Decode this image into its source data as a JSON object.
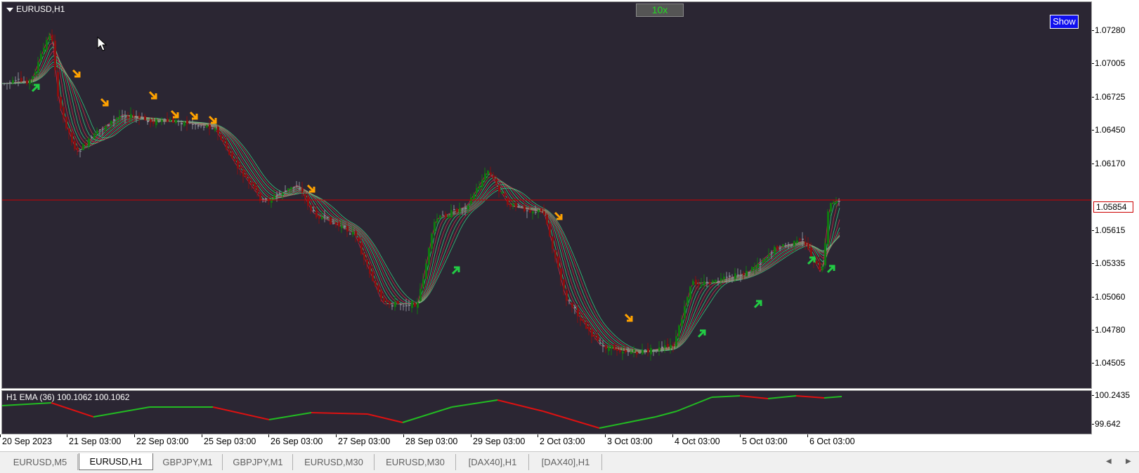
{
  "chart": {
    "symbol_label": "EURUSD,H1",
    "zoom_label": "10x",
    "show_label": "Show",
    "indicator_label": "H1 EMA (36) 100.1062 100.1062",
    "current_price": "1.05854",
    "current_price_value": 1.05854
  },
  "price_axis": {
    "ticks": [
      "1.07280",
      "1.07005",
      "1.06725",
      "1.06450",
      "1.06170",
      "1.05615",
      "1.05335",
      "1.05060",
      "1.04780",
      "1.04505"
    ]
  },
  "indicator_axis": {
    "ticks": [
      "100.2435",
      "99.642"
    ]
  },
  "time_axis": {
    "ticks": [
      "20 Sep 2023",
      "21 Sep 03:00",
      "22 Sep 03:00",
      "25 Sep 03:00",
      "26 Sep 03:00",
      "27 Sep 03:00",
      "28 Sep 03:00",
      "29 Sep 03:00",
      "2 Oct 03:00",
      "3 Oct 03:00",
      "4 Oct 03:00",
      "5 Oct 03:00",
      "6 Oct 03:00"
    ]
  },
  "tabs": [
    {
      "label": "EURUSD,M5",
      "active": false
    },
    {
      "label": "EURUSD,H1",
      "active": true
    },
    {
      "label": "GBPJPY,M1",
      "active": false
    },
    {
      "label": "GBPJPY,M1",
      "active": false
    },
    {
      "label": "EURUSD,M30",
      "active": false
    },
    {
      "label": "EURUSD,M30",
      "active": false
    },
    {
      "label": "[DAX40],H1",
      "active": false
    },
    {
      "label": "[DAX40],H1",
      "active": false
    }
  ],
  "nav": {
    "left_icon": "scroll-left-icon",
    "right_icon": "scroll-right-icon"
  },
  "colors": {
    "background": "#2b2633",
    "bull": "#0f7a0f",
    "bear": "#8b0f0f",
    "neutral": "#8a8d99",
    "ribbon_up": "#33ff99",
    "ribbon_down": "#ff2a4f",
    "arrow_sell": "#ffa200",
    "arrow_buy": "#22cc44",
    "price_line": "#cc0000"
  }
}
